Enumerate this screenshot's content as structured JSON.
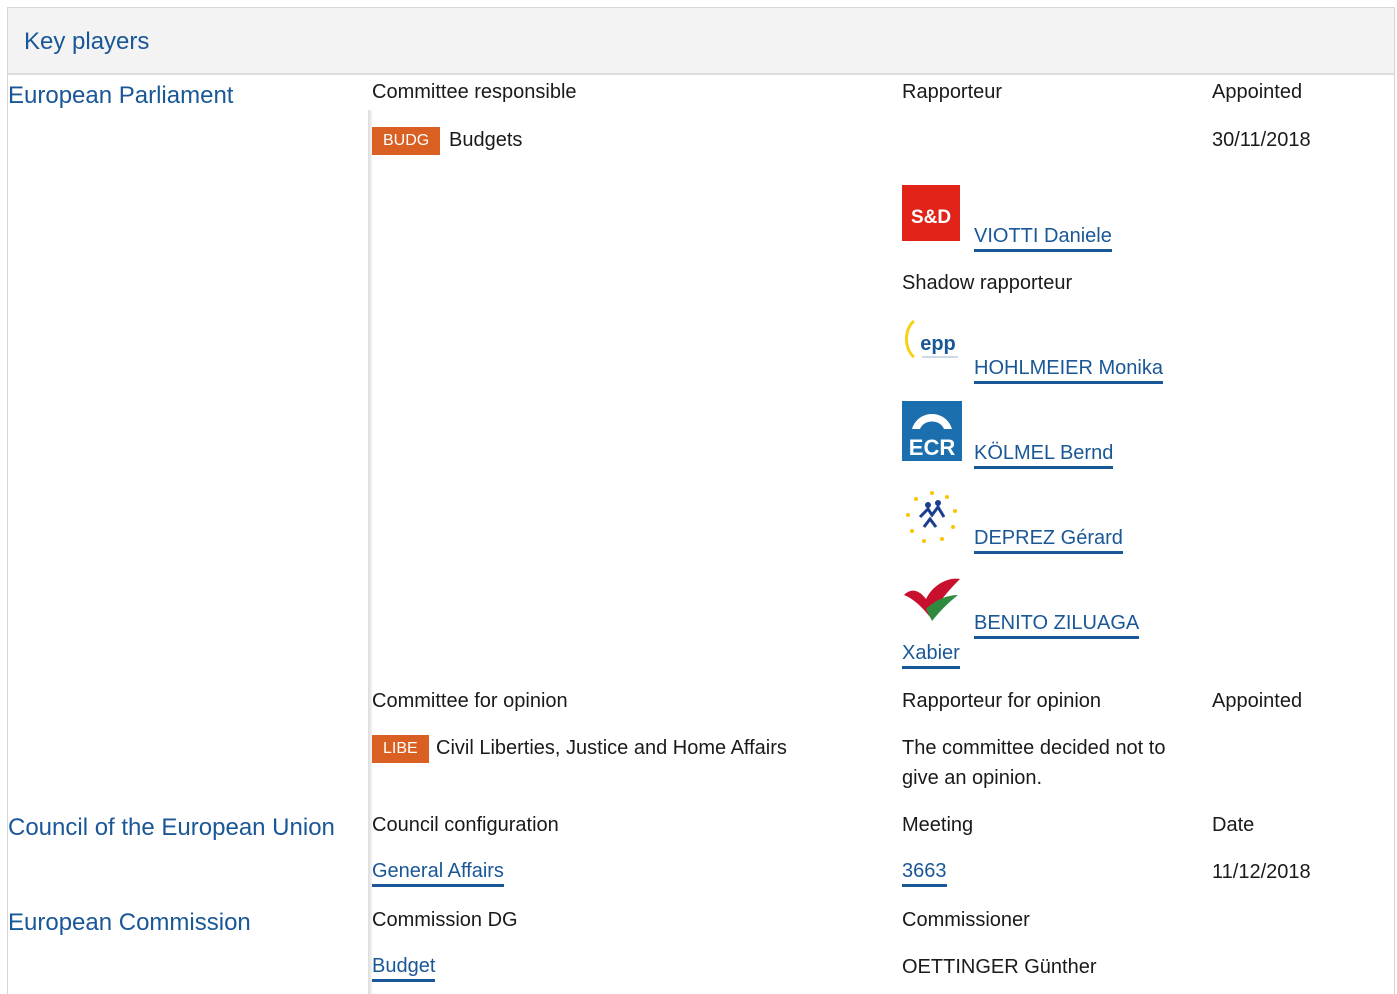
{
  "header": {
    "title": "Key players"
  },
  "ep": {
    "institution": "European Parliament",
    "responsible": {
      "col_committee": "Committee responsible",
      "col_rapporteur": "Rapporteur",
      "col_appointed": "Appointed",
      "committee_code": "BUDG",
      "committee_name": "Budgets",
      "appointed": "30/11/2018",
      "rapporteur_group_logo": "sd-logo",
      "rapporteur": "VIOTTI Daniele",
      "shadow_label": "Shadow rapporteur",
      "shadows": [
        {
          "name": "HOHLMEIER Monika",
          "logo": "epp-logo"
        },
        {
          "name": "KÖLMEL Bernd",
          "logo": "ecr-logo"
        },
        {
          "name": "DEPREZ Gérard",
          "logo": "alde-logo"
        },
        {
          "name_line1": "BENITO ZILUAGA",
          "name_line2": "Xabier",
          "logo": "gue-ngl-logo"
        }
      ]
    },
    "opinion": {
      "col_committee": "Committee for opinion",
      "col_rapporteur": "Rapporteur for opinion",
      "col_appointed": "Appointed",
      "committee_code": "LIBE",
      "committee_name": "Civil Liberties, Justice and Home Affairs",
      "note": "The committee decided not to give an opinion."
    }
  },
  "council": {
    "institution": "Council of the European Union",
    "col_configuration": "Council configuration",
    "col_meeting": "Meeting",
    "col_date": "Date",
    "configuration": "General Affairs",
    "meeting": "3663",
    "date": "11/12/2018"
  },
  "commission": {
    "institution": "European Commission",
    "col_dg": "Commission DG",
    "col_commissioner": "Commissioner",
    "dg": "Budget",
    "commissioner": "OETTINGER Günther"
  },
  "colors": {
    "link": "#1a5797",
    "badge": "#d95f23",
    "header_bg": "#f3f3f3"
  }
}
